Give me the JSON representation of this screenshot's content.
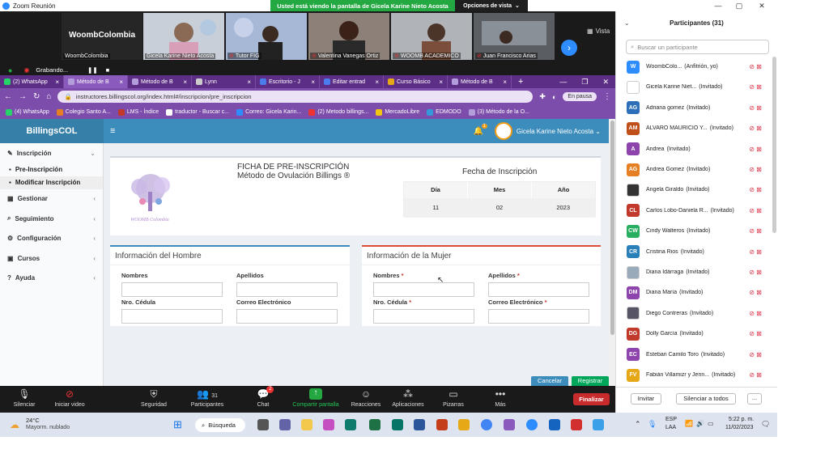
{
  "zoom": {
    "window_title": "Zoom Reunión",
    "share_banner": "Usted está viendo la pantalla de Gicela Karine Nieto Acosta",
    "view_options": "Opciones de vista",
    "view_label": "Vista",
    "recording": "Grabando...",
    "tiles": [
      {
        "big": "WoombColombia",
        "label": "WoombColombia"
      },
      {
        "label": "Gicela Karine Nieto Acosta"
      },
      {
        "label": "Tutor FIG"
      },
      {
        "label": "Valentina Vanegas Ortiz"
      },
      {
        "label": "WOOMB ACADEMICO"
      },
      {
        "label": "Juan Francisco Arias"
      }
    ],
    "toolbar": [
      {
        "label": "Silenciar",
        "icon": "mic-icon"
      },
      {
        "label": "Iniciar video",
        "icon": "video-off-icon"
      },
      {
        "label": "Seguridad",
        "icon": "shield-icon"
      },
      {
        "label": "Participantes",
        "icon": "participants-icon",
        "count": "31"
      },
      {
        "label": "Chat",
        "icon": "chat-icon",
        "badge": "2"
      },
      {
        "label": "Compartir pantalla",
        "icon": "share-icon"
      },
      {
        "label": "Reacciones",
        "icon": "reactions-icon"
      },
      {
        "label": "Aplicaciones",
        "icon": "apps-icon"
      },
      {
        "label": "Pizarras",
        "icon": "whiteboard-icon"
      },
      {
        "label": "Más",
        "icon": "more-icon"
      }
    ],
    "end_button": "Finalizar"
  },
  "browser": {
    "tabs": [
      "(2) WhatsApp",
      "Método de B",
      "Método de B",
      "Lynn",
      "Escritorio - J",
      "Editar entrad",
      "Curso Básico",
      "Método de B"
    ],
    "url": "instructores.billingscol.org/index.html#/inscripcion/pre_inscripcion",
    "pause": "En pausa",
    "bookmarks": [
      "(4) WhatsApp",
      "Colegio Santo A...",
      "LMS - Índice",
      "traductor - Buscar c...",
      "Correo: Gicela Karin...",
      "(2) Metodo billings...",
      "MercadoLibre",
      "EDMODO",
      "(3) Método de la O..."
    ]
  },
  "app": {
    "brand": "BillingsCOL",
    "user": "Gicela Karine Nieto Acosta",
    "notif_count": "1",
    "sidebar": {
      "inscripcion": "Inscripción",
      "pre": "Pre-Inscripción",
      "modificar": "Modificar Inscripción",
      "gestionar": "Gestionar",
      "seguimiento": "Seguimiento",
      "configuracion": "Configuración",
      "cursos": "Cursos",
      "ayuda": "Ayuda"
    },
    "form": {
      "title": "FICHA DE PRE-INSCRIPCIÓN",
      "subtitle": "Método de Ovulación Billings ®",
      "logo_caption": "WOOMB Colombia",
      "date_title": "Fecha de Inscripción",
      "date_headers": [
        "Día",
        "Mes",
        "Año"
      ],
      "date_values": [
        "11",
        "02",
        "2023"
      ],
      "hombre_title": "Información del Hombre",
      "mujer_title": "Información de la Mujer",
      "nombres": "Nombres",
      "apellidos": "Apellidos",
      "cedula": "Nro. Cédula",
      "correo": "Correo Electrónico",
      "req": "*",
      "cancel": "Cancelar",
      "register": "Registrar"
    }
  },
  "participants": {
    "title": "Participantes (31)",
    "search_placeholder": "Buscar un participante",
    "list": [
      {
        "initials": "W",
        "color": "#2d8cff",
        "name": "WoombColo...",
        "role": "(Anfitrión, yo)"
      },
      {
        "initials": "",
        "color": "#ffffff",
        "name": "Gicela Karine Niet...",
        "role": "(Invitado)"
      },
      {
        "initials": "AG",
        "color": "#2d6fb8",
        "name": "Adriana gomez",
        "role": "(Invitado)"
      },
      {
        "initials": "AM",
        "color": "#c0501a",
        "name": "ALVARO MAURICIO Y...",
        "role": "(Invitado)"
      },
      {
        "initials": "A",
        "color": "#8e44ad",
        "name": "Andrea",
        "role": "(Invitado)"
      },
      {
        "initials": "AG",
        "color": "#e67e22",
        "name": "Andrea Gomez",
        "role": "(Invitado)"
      },
      {
        "initials": "",
        "color": "#333333",
        "name": "Angela Giraldo",
        "role": "(Invitado)"
      },
      {
        "initials": "CL",
        "color": "#c0392b",
        "name": "Carlos Lobo-Daniela R...",
        "role": "(Invitado)"
      },
      {
        "initials": "CW",
        "color": "#27ae60",
        "name": "Cindy Walteros",
        "role": "(Invitado)"
      },
      {
        "initials": "CR",
        "color": "#2980b9",
        "name": "Cristina Rios",
        "role": "(Invitado)"
      },
      {
        "initials": "",
        "color": "#9ab",
        "name": "Diana Idárraga",
        "role": "(Invitado)"
      },
      {
        "initials": "DM",
        "color": "#8e44ad",
        "name": "Diana María",
        "role": "(Invitado)"
      },
      {
        "initials": "",
        "color": "#556",
        "name": "Diego Contreras",
        "role": "(Invitado)"
      },
      {
        "initials": "DG",
        "color": "#c0392b",
        "name": "Dolly García",
        "role": "(Invitado)"
      },
      {
        "initials": "EC",
        "color": "#8e44ad",
        "name": "Esteban Camilo Toro",
        "role": "(Invitado)"
      },
      {
        "initials": "FV",
        "color": "#e6a817",
        "name": "Fabián Villamizr y Jenn...",
        "role": "(Invitado)"
      }
    ],
    "invite": "Invitar",
    "mute_all": "Silenciar a todos",
    "more": "..."
  },
  "taskbar": {
    "temp": "24°C",
    "weather": "Mayorm. nublado",
    "search": "Búsqueda",
    "lang1": "ESP",
    "lang2": "LAA",
    "time": "5:22 p. m.",
    "date": "11/02/2023"
  }
}
